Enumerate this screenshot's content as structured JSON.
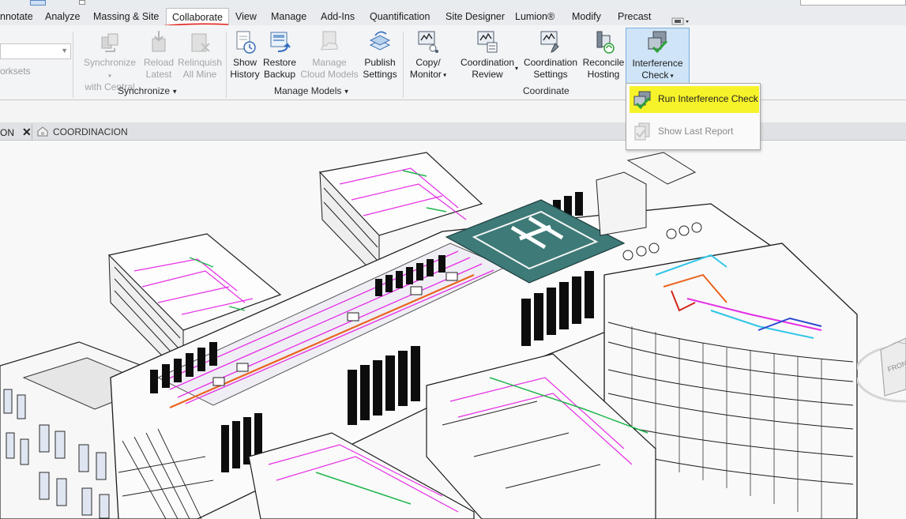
{
  "tabs": [
    {
      "label": "nnotate"
    },
    {
      "label": "Analyze"
    },
    {
      "label": "Massing & Site"
    },
    {
      "label": "Collaborate",
      "active": true
    },
    {
      "label": "View"
    },
    {
      "label": "Manage"
    },
    {
      "label": "Add-Ins"
    },
    {
      "label": "Quantification"
    },
    {
      "label": "Site Designer"
    },
    {
      "label": "Lumion®"
    },
    {
      "label": "Modify"
    },
    {
      "label": "Precast"
    }
  ],
  "ribbon": {
    "worksets_label": "orksets",
    "buttons": {
      "synchronize": {
        "line1": "Synchronize",
        "line2": "with Central"
      },
      "reload": {
        "line1": "Reload",
        "line2": "Latest"
      },
      "relinquish": {
        "line1": "Relinquish",
        "line2": "All Mine"
      },
      "show_history": {
        "line1": "Show",
        "line2": "History"
      },
      "restore_backup": {
        "line1": "Restore",
        "line2": "Backup"
      },
      "manage_cloud": {
        "line1": "Manage",
        "line2": "Cloud Models"
      },
      "publish_settings": {
        "line1": "Publish",
        "line2": "Settings"
      },
      "copy_monitor": {
        "line1": "Copy/",
        "line2": "Monitor"
      },
      "coord_review": {
        "line1": "Coordination",
        "line2": "Review"
      },
      "coord_settings": {
        "line1": "Coordination",
        "line2": "Settings"
      },
      "reconcile": {
        "line1": "Reconcile",
        "line2": "Hosting"
      },
      "interference": {
        "line1": "Interference",
        "line2": "Check"
      }
    },
    "panels": {
      "synchronize": "Synchronize",
      "manage_models": "Manage Models",
      "coordinate": "Coordinate"
    }
  },
  "dropdown": {
    "run": "Run Interference Check",
    "last_report": "Show Last Report"
  },
  "view_tabs": [
    {
      "label": "ON"
    },
    {
      "label": "COORDINACION"
    }
  ],
  "viewcube": {
    "face": "FRONT"
  },
  "colors": {
    "accent_highlight": "#f7f32a",
    "selected_button": "#cfe4f7",
    "mep_pipes": "#e52ee5",
    "helipad": "#3d7a78"
  }
}
